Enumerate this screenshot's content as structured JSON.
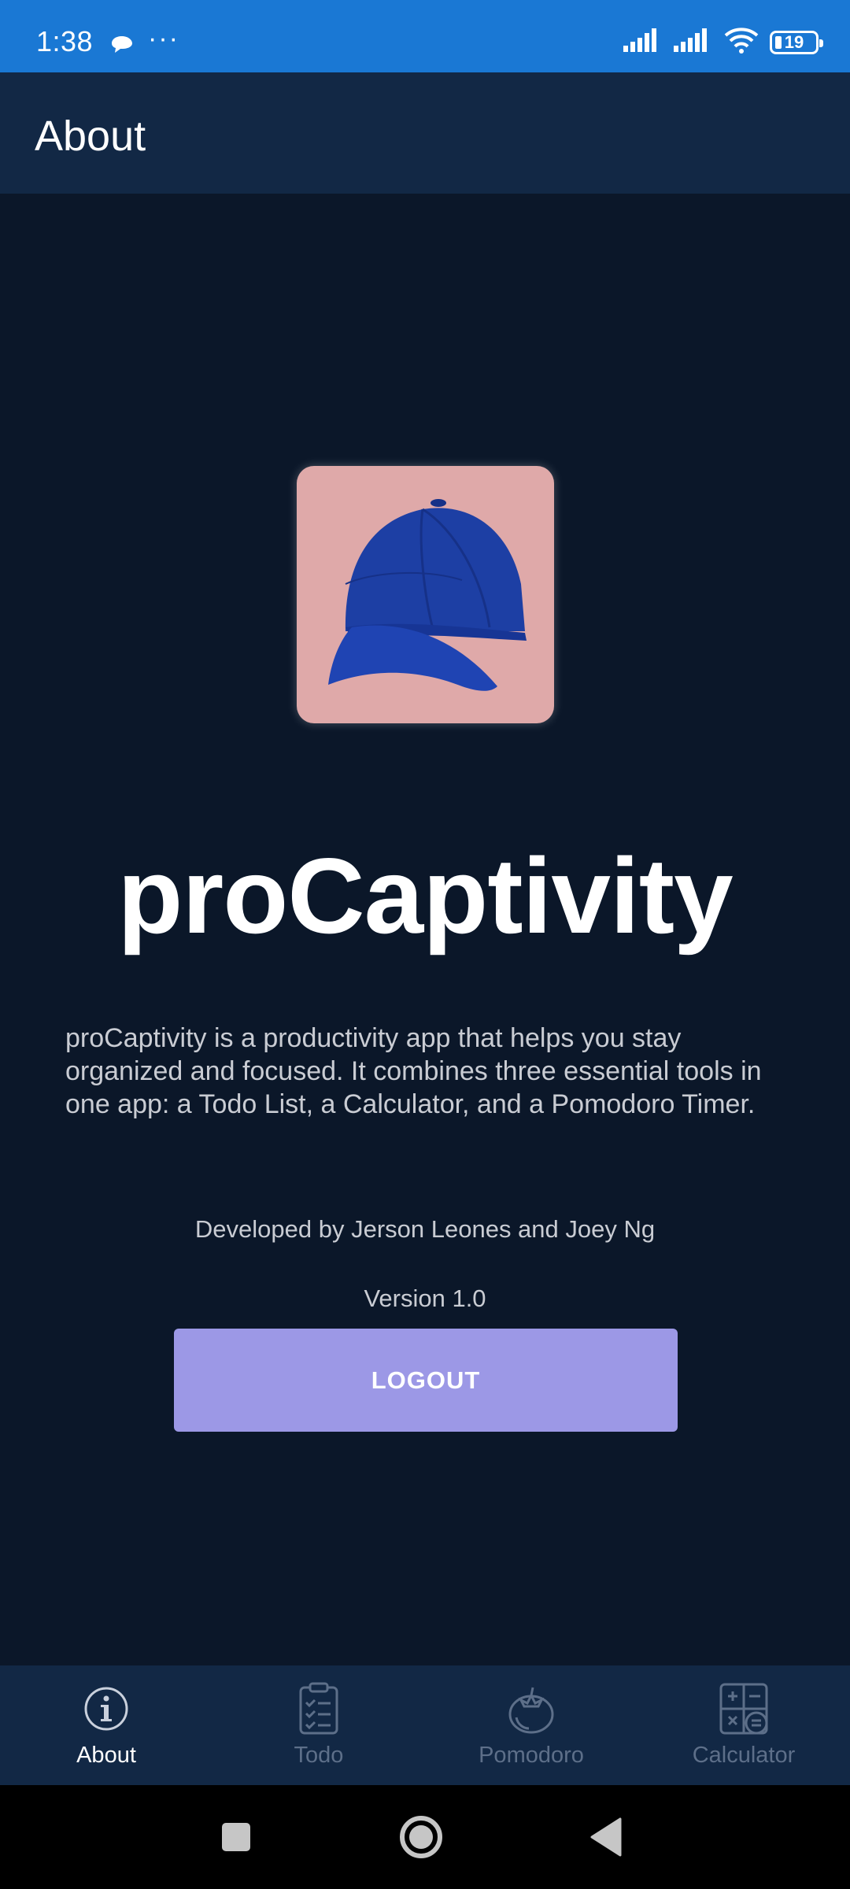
{
  "status_bar": {
    "time": "1:38",
    "more": "···",
    "battery_level": "19"
  },
  "app_bar": {
    "title": "About"
  },
  "main": {
    "app_name": "proCaptivity",
    "description": "proCaptivity is a productivity app that helps you stay organized and focused. It combines three essential tools in one app: a Todo List, a Calculator, and a Pomodoro Timer.",
    "developers": "Developed by Jerson Leones and Joey Ng",
    "version": "Version 1.0",
    "logout_label": "LOGOUT"
  },
  "bottom_nav": {
    "items": [
      {
        "label": "About",
        "icon": "info-icon",
        "active": true
      },
      {
        "label": "Todo",
        "icon": "clipboard-checklist-icon",
        "active": false
      },
      {
        "label": "Pomodoro",
        "icon": "tomato-icon",
        "active": false
      },
      {
        "label": "Calculator",
        "icon": "calculator-icon",
        "active": false
      }
    ]
  },
  "colors": {
    "status_bar": "#1a78d4",
    "app_bar": "#122845",
    "background": "#0b1729",
    "logout_button": "#9c98e6",
    "logo_tile": "#dfa9a9"
  }
}
